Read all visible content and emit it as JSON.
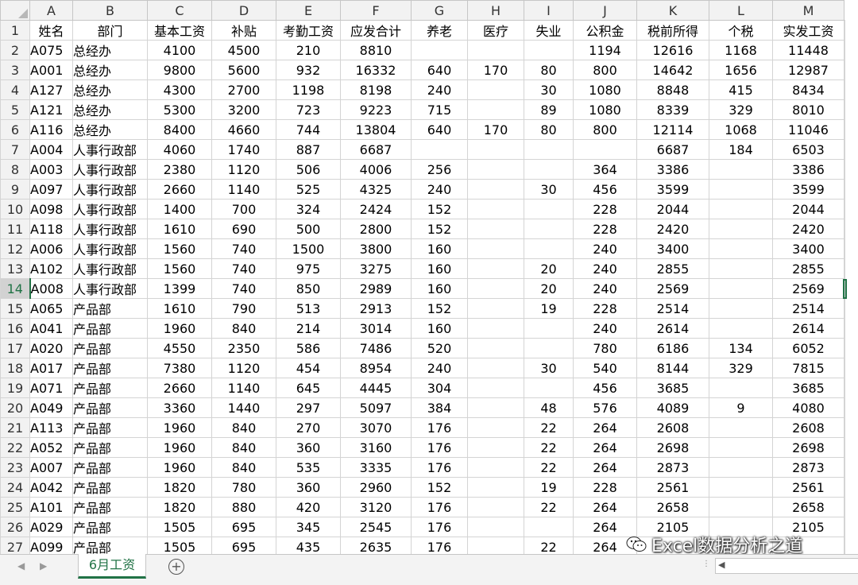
{
  "columns": [
    "A",
    "B",
    "C",
    "D",
    "E",
    "F",
    "G",
    "H",
    "I",
    "J",
    "K",
    "L",
    "M"
  ],
  "header_row": [
    "姓名",
    "部门",
    "基本工资",
    "补贴",
    "考勤工资",
    "应发合计",
    "养老",
    "医疗",
    "失业",
    "公积金",
    "税前所得",
    "个税",
    "实发工资"
  ],
  "rows": [
    [
      "A075",
      "总经办",
      "4100",
      "4500",
      "210",
      "8810",
      "",
      "",
      "",
      "1194",
      "12616",
      "1168",
      "11448"
    ],
    [
      "A001",
      "总经办",
      "9800",
      "5600",
      "932",
      "16332",
      "640",
      "170",
      "80",
      "800",
      "14642",
      "1656",
      "12987"
    ],
    [
      "A127",
      "总经办",
      "4300",
      "2700",
      "1198",
      "8198",
      "240",
      "",
      "30",
      "1080",
      "8848",
      "415",
      "8434"
    ],
    [
      "A121",
      "总经办",
      "5300",
      "3200",
      "723",
      "9223",
      "715",
      "",
      "89",
      "1080",
      "8339",
      "329",
      "8010"
    ],
    [
      "A116",
      "总经办",
      "8400",
      "4660",
      "744",
      "13804",
      "640",
      "170",
      "80",
      "800",
      "12114",
      "1068",
      "11046"
    ],
    [
      "A004",
      "人事行政部",
      "4060",
      "1740",
      "887",
      "6687",
      "",
      "",
      "",
      "",
      "6687",
      "184",
      "6503"
    ],
    [
      "A003",
      "人事行政部",
      "2380",
      "1120",
      "506",
      "4006",
      "256",
      "",
      "",
      "364",
      "3386",
      "",
      "3386"
    ],
    [
      "A097",
      "人事行政部",
      "2660",
      "1140",
      "525",
      "4325",
      "240",
      "",
      "30",
      "456",
      "3599",
      "",
      "3599"
    ],
    [
      "A098",
      "人事行政部",
      "1400",
      "700",
      "324",
      "2424",
      "152",
      "",
      "",
      "228",
      "2044",
      "",
      "2044"
    ],
    [
      "A118",
      "人事行政部",
      "1610",
      "690",
      "500",
      "2800",
      "152",
      "",
      "",
      "228",
      "2420",
      "",
      "2420"
    ],
    [
      "A006",
      "人事行政部",
      "1560",
      "740",
      "1500",
      "3800",
      "160",
      "",
      "",
      "240",
      "3400",
      "",
      "3400"
    ],
    [
      "A102",
      "人事行政部",
      "1560",
      "740",
      "975",
      "3275",
      "160",
      "",
      "20",
      "240",
      "2855",
      "",
      "2855"
    ],
    [
      "A008",
      "人事行政部",
      "1399",
      "740",
      "850",
      "2989",
      "160",
      "",
      "20",
      "240",
      "2569",
      "",
      "2569"
    ],
    [
      "A065",
      "产品部",
      "1610",
      "790",
      "513",
      "2913",
      "152",
      "",
      "19",
      "228",
      "2514",
      "",
      "2514"
    ],
    [
      "A041",
      "产品部",
      "1960",
      "840",
      "214",
      "3014",
      "160",
      "",
      "",
      "240",
      "2614",
      "",
      "2614"
    ],
    [
      "A020",
      "产品部",
      "4550",
      "2350",
      "586",
      "7486",
      "520",
      "",
      "",
      "780",
      "6186",
      "134",
      "6052"
    ],
    [
      "A017",
      "产品部",
      "7380",
      "1120",
      "454",
      "8954",
      "240",
      "",
      "30",
      "540",
      "8144",
      "329",
      "7815"
    ],
    [
      "A071",
      "产品部",
      "2660",
      "1140",
      "645",
      "4445",
      "304",
      "",
      "",
      "456",
      "3685",
      "",
      "3685"
    ],
    [
      "A049",
      "产品部",
      "3360",
      "1440",
      "297",
      "5097",
      "384",
      "",
      "48",
      "576",
      "4089",
      "9",
      "4080"
    ],
    [
      "A113",
      "产品部",
      "1960",
      "840",
      "270",
      "3070",
      "176",
      "",
      "22",
      "264",
      "2608",
      "",
      "2608"
    ],
    [
      "A052",
      "产品部",
      "1960",
      "840",
      "360",
      "3160",
      "176",
      "",
      "22",
      "264",
      "2698",
      "",
      "2698"
    ],
    [
      "A007",
      "产品部",
      "1960",
      "840",
      "535",
      "3335",
      "176",
      "",
      "22",
      "264",
      "2873",
      "",
      "2873"
    ],
    [
      "A042",
      "产品部",
      "1820",
      "780",
      "360",
      "2960",
      "152",
      "",
      "19",
      "228",
      "2561",
      "",
      "2561"
    ],
    [
      "A101",
      "产品部",
      "1820",
      "880",
      "420",
      "3120",
      "176",
      "",
      "22",
      "264",
      "2658",
      "",
      "2658"
    ],
    [
      "A029",
      "产品部",
      "1505",
      "695",
      "345",
      "2545",
      "176",
      "",
      "",
      "264",
      "2105",
      "",
      "2105"
    ],
    [
      "A099",
      "产品部",
      "1505",
      "695",
      "435",
      "2635",
      "176",
      "",
      "22",
      "264",
      "",
      "",
      ""
    ]
  ],
  "sheet_tab": "6月工资",
  "add_sheet_label": "+",
  "nav_prev": "◀",
  "nav_next": "▶",
  "watermark": "Excel数据分析之道",
  "active_row": 14,
  "accent_color": "#217346"
}
